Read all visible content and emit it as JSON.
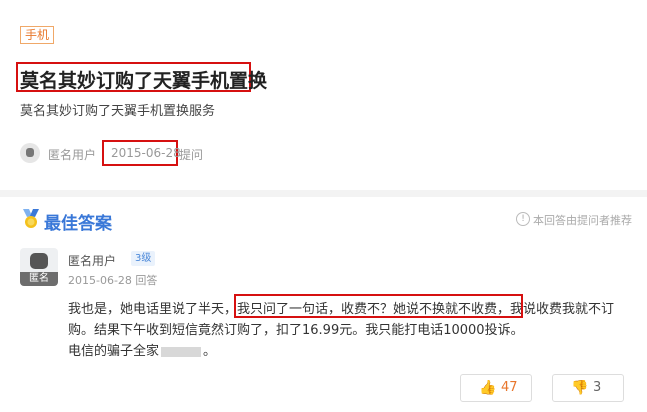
{
  "question": {
    "tag": "手机",
    "title": "莫名其妙订购了天翼手机置换",
    "description": "莫名其妙订购了天翼手机置换服务",
    "asker": "匿名用户",
    "asked_date": "2015-06-28",
    "asked_suffix": "提问"
  },
  "answer": {
    "section_title": "最佳答案",
    "note": "本回答由提问者推荐",
    "user": "匿名用户",
    "avatar_badge": "匿名",
    "level": "3级",
    "date": "2015-06-28 回答",
    "line1_a": "我也是，她电话里说了半天，",
    "line1_highlight": "我只问了一句话，收费不？她说不换就不收费",
    "line1_b": "，我说收费我就不订",
    "line2": "购。结果下午收到短信竟然订购了，扣了16.99元。我只能打电话10000投诉。",
    "line3_a": "电信的骗子全家",
    "line3_b": "。",
    "likes": "47",
    "dislikes": "3"
  },
  "colors": {
    "accent": "#3a78d8",
    "highlight_border": "#d61010",
    "tag": "#e8782c"
  }
}
